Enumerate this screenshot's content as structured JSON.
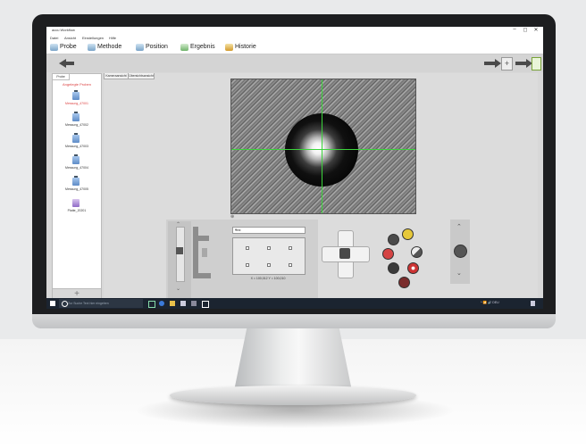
{
  "window": {
    "title": "accu Workflow",
    "controls": {
      "minimize": "–",
      "maximize": "◻",
      "close": "✕"
    }
  },
  "menu": [
    "Datei",
    "Ansicht",
    "Einstellungen",
    "Hilfe"
  ],
  "tabs": [
    {
      "label": "Probe",
      "icon": "sample-icon"
    },
    {
      "label": "Methode",
      "icon": "method-icon"
    },
    {
      "label": "Position",
      "icon": "position-icon",
      "active": true
    },
    {
      "label": "Ergebnis",
      "icon": "result-icon"
    },
    {
      "label": "Historie",
      "icon": "history-icon"
    }
  ],
  "sidebar": {
    "tab_label": "Probe",
    "header": "Angelegte Proben",
    "samples": [
      {
        "label": "Messung_47001",
        "selected": true
      },
      {
        "label": "Messung_47002"
      },
      {
        "label": "Messung_47003"
      },
      {
        "label": "Messung_47004"
      },
      {
        "label": "Messung_47005"
      },
      {
        "label": "Platte_20201"
      }
    ],
    "add_label": "+"
  },
  "main": {
    "subtabs": [
      "Kameraansicht",
      "Übersichtsansicht"
    ],
    "zoom_label": "⊕",
    "dropdown_value": "Test",
    "coordinates": "X = 100,012  Y = 100,010"
  },
  "taskbar": {
    "search_placeholder": "Zur Suche Text hier eingeben",
    "time": "^ 📶 🔊 DEU"
  },
  "colors": {
    "crosshair": "#3bd33b",
    "accent_red": "#d44444",
    "bezel": "#1d1e20"
  }
}
